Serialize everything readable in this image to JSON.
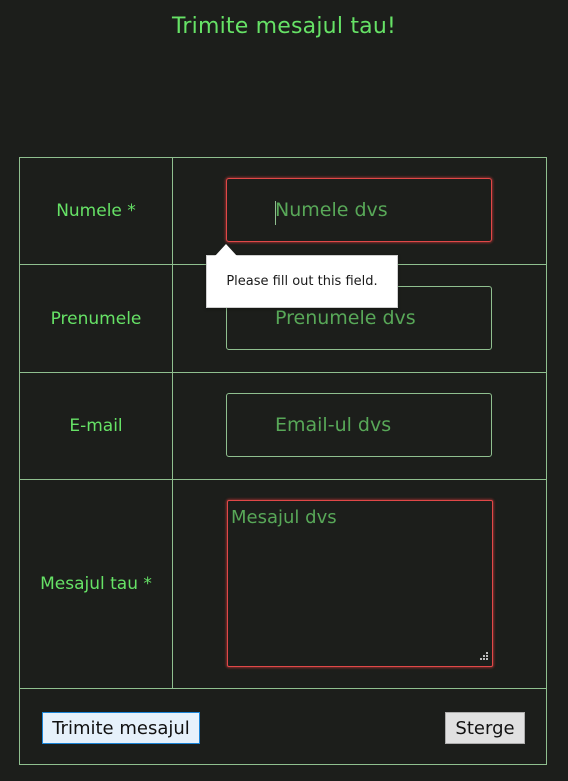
{
  "page": {
    "title": "Trimite mesajul tau!"
  },
  "form": {
    "fields": [
      {
        "label": "Numele *",
        "placeholder": "Numele dvs",
        "value": ""
      },
      {
        "label": "Prenumele",
        "placeholder": "Prenumele dvs",
        "value": ""
      },
      {
        "label": "E-mail",
        "placeholder": "Email-ul dvs",
        "value": ""
      }
    ],
    "message": {
      "label": "Mesajul tau *",
      "placeholder": "Mesajul dvs",
      "value": ""
    },
    "submit_label": "Trimite mesajul",
    "reset_label": "Sterge"
  },
  "validation": {
    "tooltip_text": "Please fill out this field."
  },
  "colors": {
    "background": "#1c1e1b",
    "accent_text": "#66e266",
    "placeholder_text": "#58a858",
    "border": "#8fbf8f",
    "invalid_border": "#e04848",
    "submit_focus_border": "#1a84d6"
  }
}
